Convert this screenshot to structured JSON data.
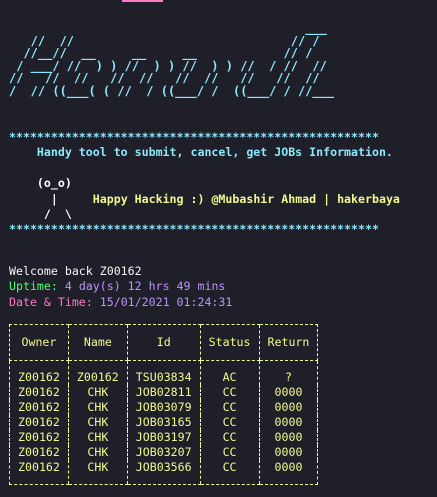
{
  "colors": {
    "background": "#1e1f29",
    "cyan": "#8be9fd",
    "yellow": "#f1fa8c",
    "green": "#50fa7b",
    "purple": "#bd93f9",
    "pink": "#ff79c6",
    "tab_indicator": "#ff79c6"
  },
  "banner": {
    "ascii_art": "                                         ___\n   //  //                              // /\n  //__//  __     __     __            // /\n / ___/ //  ) ) //  ) ) //  ) ) //  / //  //\n//   //  //   //  //   //  //   //   //  //\n/  // ((___( ( //  / ((___/ /  ((___/ / //___"
  },
  "intro": {
    "stars": "*****************************************************",
    "tagline": "Handy tool to submit, cancel, get JOBs Information.",
    "mascot_line1": "(o_o)",
    "mascot_line2": "|",
    "mascot_line3": "/  \\",
    "hacking_line": "Happy Hacking :) @Mubashir Ahmad | hakerbaya"
  },
  "session": {
    "welcome": "Welcome back Z00162",
    "uptime_label": "Uptime:",
    "uptime_value": "4 day(s) 12 hrs 49 mins",
    "date_label": "Date & Time:",
    "date_value": "15/01/2021 01:24:31"
  },
  "jobs_table": {
    "headers": [
      "Owner",
      "Name",
      "Id",
      "Status",
      "Return"
    ],
    "rows": [
      [
        "Z00162",
        "Z00162",
        "TSU03834",
        "AC",
        "?"
      ],
      [
        "Z00162",
        "CHK",
        "JOB02811",
        "CC",
        "0000"
      ],
      [
        "Z00162",
        "CHK",
        "JOB03079",
        "CC",
        "0000"
      ],
      [
        "Z00162",
        "CHK",
        "JOB03165",
        "CC",
        "0000"
      ],
      [
        "Z00162",
        "CHK",
        "JOB03197",
        "CC",
        "0000"
      ],
      [
        "Z00162",
        "CHK",
        "JOB03207",
        "CC",
        "0000"
      ],
      [
        "Z00162",
        "CHK",
        "JOB03566",
        "CC",
        "0000"
      ]
    ]
  }
}
